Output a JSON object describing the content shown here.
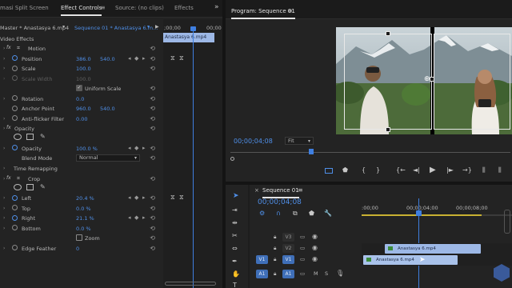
{
  "left_tabs": [
    "masi Split Screen",
    "Effect Controls",
    "Source: (no clips)",
    "Effects"
  ],
  "left_more": "»",
  "ec": {
    "master_label": "Master * Anastasya 6.mp4",
    "sequence_label": "Sequence 01 * Anastasya 6.m...",
    "mini_time1": ";00;00",
    "mini_time2": "00;00",
    "clip_name": "Anastasya 6.mp4",
    "section_video_effects": "Video Effects",
    "fx_motion": "Motion",
    "position": {
      "label": "Position",
      "x": "386.0",
      "y": "540.0"
    },
    "scale": {
      "label": "Scale",
      "value": "100.0"
    },
    "scale_width": {
      "label": "Scale Width",
      "value": "100.0"
    },
    "uniform_scale": "Uniform Scale",
    "rotation": {
      "label": "Rotation",
      "value": "0.0"
    },
    "anchor_point": {
      "label": "Anchor Point",
      "x": "960.0",
      "y": "540.0"
    },
    "anti_flicker": {
      "label": "Anti-flicker Filter",
      "value": "0.00"
    },
    "fx_opacity": "Opacity",
    "opacity": {
      "label": "Opacity",
      "value": "100.0 %"
    },
    "blend_mode": {
      "label": "Blend Mode",
      "value": "Normal"
    },
    "time_remapping": "Time Remapping",
    "fx_crop": "Crop",
    "left": {
      "label": "Left",
      "value": "20.4 %"
    },
    "top": {
      "label": "Top",
      "value": "0.0 %"
    },
    "right": {
      "label": "Right",
      "value": "21.1 %"
    },
    "bottom": {
      "label": "Bottom",
      "value": "0.0 %"
    },
    "zoom": "Zoom",
    "edge_feather": {
      "label": "Edge Feather",
      "value": "0"
    }
  },
  "program": {
    "title": "Program: Sequence 01",
    "menu": "≡",
    "timecode": "00;00;04;08",
    "fit": "Fit",
    "transport": [
      "{",
      "}",
      "{←",
      "◄|",
      "▶",
      "|►",
      "→}"
    ]
  },
  "timeline": {
    "title": "Sequence 01",
    "menu": "≡",
    "timecode": "00;00;04;08",
    "ruler": [
      ":00;00",
      "00;00;04;00",
      "00;00;08;00"
    ],
    "tracks": [
      {
        "src": "",
        "name": "V3"
      },
      {
        "src": "",
        "name": "V2"
      },
      {
        "src": "V1",
        "name": "V1"
      },
      {
        "src": "A1",
        "name": "A1"
      }
    ],
    "clip_v2": "Anastasya 6.mp4",
    "clip_v1": "Anastasya 6.mp4",
    "audio_m": "M",
    "audio_s": "S"
  },
  "colors": {
    "accent_blue": "#4f8fe8",
    "clip_v2": "#9db8e6",
    "clip_v1": "#a9c2ea",
    "playhead": "#3f7fe0"
  }
}
